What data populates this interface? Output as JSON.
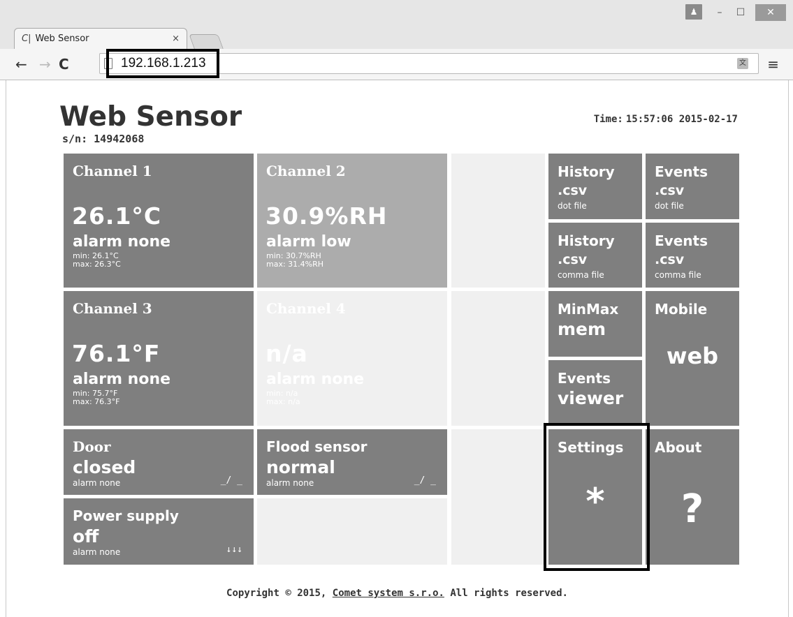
{
  "browser": {
    "tab_title": "Web Sensor",
    "tab_close": "×",
    "url": "192.168.1.213",
    "controls": {
      "minimize": "–",
      "maximize": "☐",
      "close": "✕"
    }
  },
  "header": {
    "title": "Web Sensor",
    "serial": "s/n: 14942068",
    "time_label": "Time:",
    "time_value": "15:57:06 2015-02-17"
  },
  "channels": [
    {
      "name": "Channel 1",
      "value": "26.1°C",
      "alarm": "alarm none",
      "min": "min: 26.1°C",
      "max": "max: 26.3°C"
    },
    {
      "name": "Channel 2",
      "value": "30.9%RH",
      "alarm": "alarm low",
      "min": "min: 30.7%RH",
      "max": "max: 31.4%RH"
    },
    {
      "name": "Channel 3",
      "value": "76.1°F",
      "alarm": "alarm none",
      "min": "min: 75.7°F",
      "max": "max: 76.3°F"
    },
    {
      "name": "Channel 4",
      "value": "n/a",
      "alarm": "alarm none",
      "min": "min: n/a",
      "max": "max: n/a"
    }
  ],
  "binary_inputs": [
    {
      "name": "Door",
      "state": "closed",
      "alarm": "alarm none",
      "glyph": "_/ _"
    },
    {
      "name": "Flood sensor",
      "state": "normal",
      "alarm": "alarm none",
      "glyph": "_/ _"
    },
    {
      "name": "Power supply",
      "state": "off",
      "alarm": "alarm none",
      "glyph": "↓↓↓"
    }
  ],
  "links": {
    "history_dot": {
      "title": "History",
      "ext": ".csv",
      "sub": "dot file"
    },
    "events_dot": {
      "title": "Events",
      "ext": ".csv",
      "sub": "dot file"
    },
    "history_comma": {
      "title": "History",
      "ext": ".csv",
      "sub": "comma file"
    },
    "events_comma": {
      "title": "Events",
      "ext": ".csv",
      "sub": "comma file"
    },
    "minmax": {
      "title": "MinMax",
      "sub": "mem"
    },
    "mobile": {
      "title": "Mobile",
      "sub": "web"
    },
    "events_viewer": {
      "title": "Events",
      "sub": "viewer"
    },
    "settings": {
      "title": "Settings",
      "symbol": "*"
    },
    "about": {
      "title": "About",
      "symbol": "?"
    }
  },
  "footer": {
    "prefix": "Copyright © 2015,",
    "company": "Comet system s.r.o.",
    "suffix": "All rights reserved."
  },
  "colors": {
    "tile_dark": "#7f7f7f",
    "tile_mid": "#acacac",
    "tile_empty": "#f0f0f0",
    "text_dark": "#333333"
  }
}
